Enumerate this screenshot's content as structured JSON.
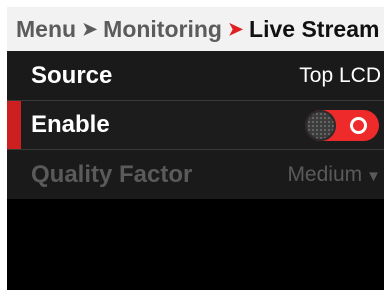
{
  "breadcrumb": {
    "items": [
      "Menu",
      "Monitoring",
      "Live Stream"
    ],
    "separator_icon": "chevron-right-icon"
  },
  "rows": {
    "source": {
      "label": "Source",
      "value": "Top LCD"
    },
    "enable": {
      "label": "Enable",
      "state": "on"
    },
    "quality": {
      "label": "Quality Factor",
      "value": "Medium",
      "disabled": true
    }
  },
  "colors": {
    "accent": "#e02020",
    "toggle_on": "#ee2a2a",
    "disabled_text": "#5a5a5a",
    "breadcrumb_bg": "#f2f2f2",
    "screen_bg": "#000000"
  }
}
